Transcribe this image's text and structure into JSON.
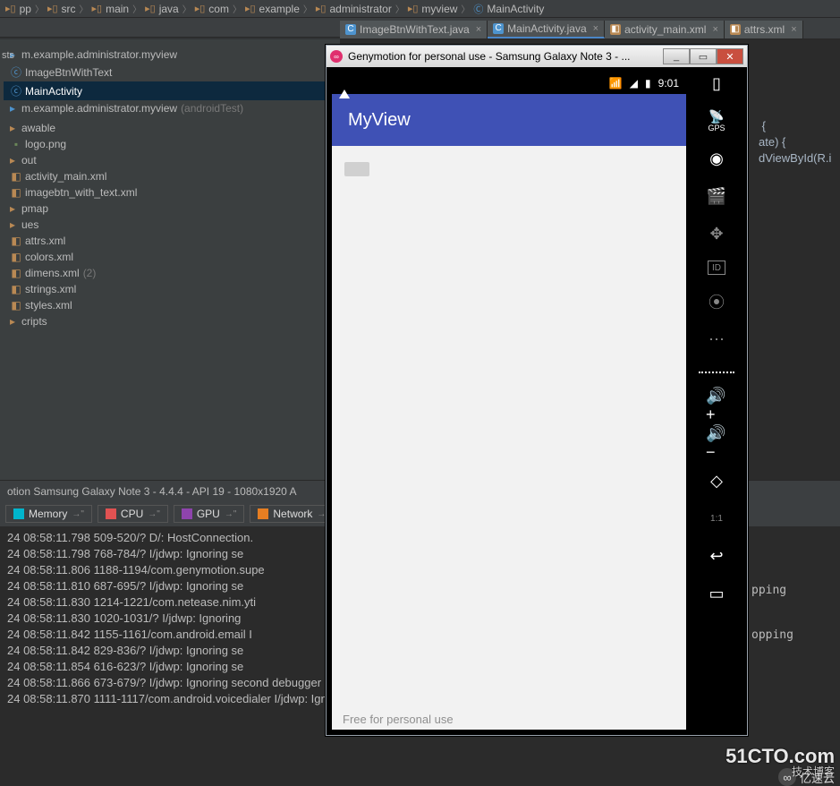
{
  "breadcrumb": [
    "pp",
    "src",
    "main",
    "java",
    "com",
    "example",
    "administrator",
    "myview",
    "MainActivity"
  ],
  "mini_toolbar": [
    "⊙",
    "↓",
    "⚙",
    "⎘",
    "⊡"
  ],
  "tabs": [
    {
      "icon": "C",
      "icon_bg": "#4e94ce",
      "label": "ImageBtnWithText.java",
      "active": false
    },
    {
      "icon": "C",
      "icon_bg": "#4e94ce",
      "label": "MainActivity.java",
      "active": true
    },
    {
      "icon": "◧",
      "icon_bg": "#b98954",
      "label": "activity_main.xml",
      "active": false
    },
    {
      "icon": "◧",
      "icon_bg": "#b98954",
      "label": "attrs.xml",
      "active": false
    }
  ],
  "side_label": "sts",
  "tree": [
    {
      "ind": 0,
      "icon": "pkg",
      "label": "m.example.administrator.myview"
    },
    {
      "ind": 1,
      "icon": "class",
      "label": "ImageBtnWithText"
    },
    {
      "ind": 1,
      "icon": "class",
      "label": "MainActivity",
      "sel": true
    },
    {
      "ind": 0,
      "icon": "pkg",
      "label": "m.example.administrator.myview",
      "hint": "(androidTest)"
    },
    {
      "ind": 0,
      "icon": "",
      "label": ""
    },
    {
      "ind": 0,
      "icon": "folder",
      "label": "awable"
    },
    {
      "ind": 1,
      "icon": "img",
      "label": "logo.png"
    },
    {
      "ind": 0,
      "icon": "folder",
      "label": "out"
    },
    {
      "ind": 1,
      "icon": "xml",
      "label": "activity_main.xml"
    },
    {
      "ind": 1,
      "icon": "xml",
      "label": "imagebtn_with_text.xml"
    },
    {
      "ind": 0,
      "icon": "folder",
      "label": "pmap"
    },
    {
      "ind": 0,
      "icon": "folder",
      "label": "ues"
    },
    {
      "ind": 1,
      "icon": "xml",
      "label": "attrs.xml"
    },
    {
      "ind": 1,
      "icon": "xml",
      "label": "colors.xml"
    },
    {
      "ind": 1,
      "icon": "xml",
      "label": "dimens.xml",
      "hint": "(2)"
    },
    {
      "ind": 1,
      "icon": "xml",
      "label": "strings.xml"
    },
    {
      "ind": 1,
      "icon": "xml",
      "label": "styles.xml"
    },
    {
      "ind": 0,
      "icon": "folder",
      "label": "cripts"
    }
  ],
  "editor_lines": [
    " {",
    "",
    "",
    "ate) {",
    "",
    "",
    "dViewById(R.i"
  ],
  "console_title": "otion Samsung Galaxy Note 3 - 4.4.4 - API 19 - 1080x1920 A",
  "filters": [
    {
      "color": "m",
      "label": "Memory"
    },
    {
      "color": "c",
      "label": "CPU"
    },
    {
      "color": "g",
      "label": "GPU"
    },
    {
      "color": "n",
      "label": "Network"
    }
  ],
  "logs": [
    "24 08:58:11.798 509-520/? D/: HostConnection.",
    "24 08:58:11.798 768-784/? I/jdwp: Ignoring se",
    "24 08:58:11.806 1188-1194/com.genymotion.supe",
    "24 08:58:11.810 687-695/? I/jdwp: Ignoring se",
    "24 08:58:11.830 1214-1221/com.netease.nim.yti",
    "24 08:58:11.830 1020-1031/? I/jdwp: Ignoring",
    "24 08:58:11.842 1155-1161/com.android.email I",
    "24 08:58:11.842 829-836/? I/jdwp: Ignoring se",
    "24 08:58:11.854 616-623/? I/jdwp: Ignoring se",
    "24 08:58:11.866 673-679/? I/jdwp: Ignoring second debugger -- accepting and dropping",
    "24 08:58:11.870 1111-1117/com.android.voicedialer I/jdwp: Ignoring second debugger -- accepting and d"
  ],
  "log_tail1": "pping",
  "log_tail2": "opping",
  "emulator": {
    "title": "Genymotion for personal use - Samsung Galaxy Note 3 - ...",
    "clock": "9:01",
    "app_title": "MyView",
    "free": "Free for personal use",
    "gps": "GPS",
    "sidebar_icons": [
      "battery",
      "gps",
      "camera",
      "clapper",
      "move",
      "id",
      "rss",
      "sms",
      "vol-up",
      "vol-down",
      "rotate",
      "fit",
      "back",
      "recent"
    ]
  },
  "watermark": {
    "top": "51CTO.com",
    "mid": "技术博客",
    "sub": "亿速云"
  }
}
